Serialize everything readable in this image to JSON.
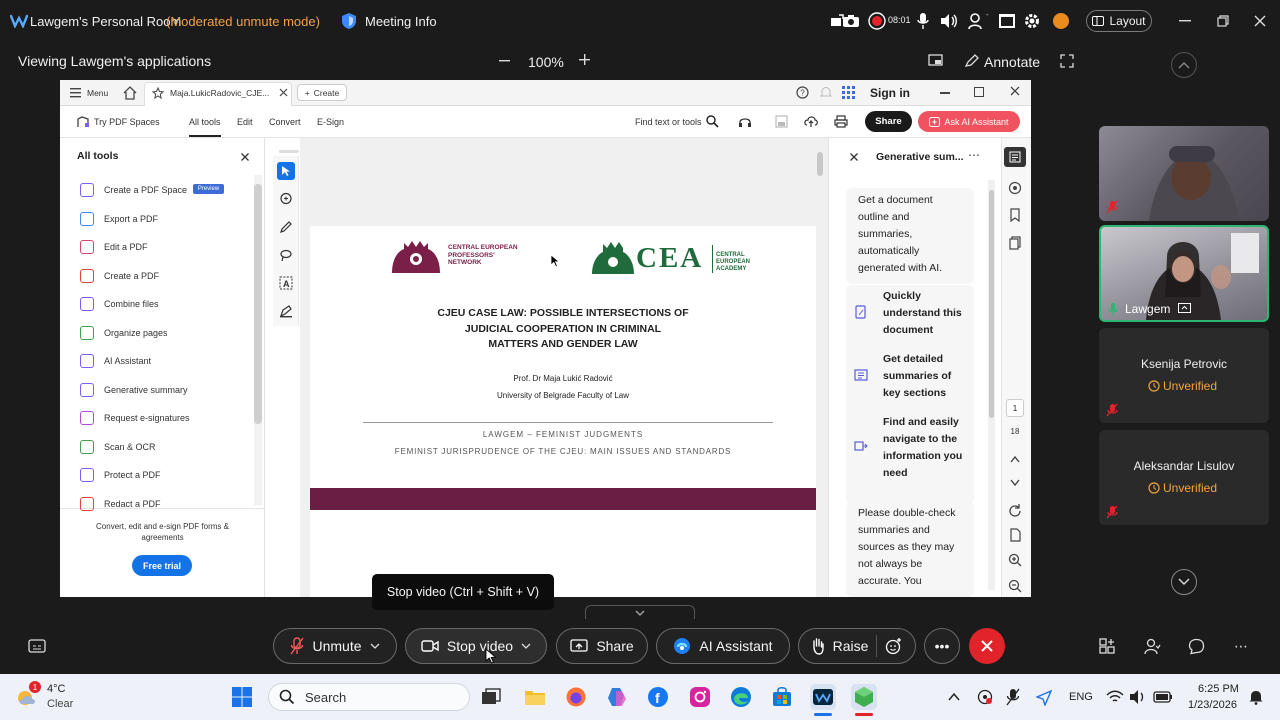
{
  "titlebar": {
    "room_name": "Lawgem's Personal Room",
    "mode": "(Moderated unmute mode)",
    "meeting_info": "Meeting Info",
    "clock_badge": "08:01",
    "layout": "Layout"
  },
  "sharebar": {
    "viewing": "Viewing Lawgem's applications",
    "zoom": "100%",
    "annotate": "Annotate"
  },
  "pdf": {
    "menu": "Menu",
    "tab_title": "Maja.LukicRadovic_CJE...",
    "create": "Create",
    "sign_in": "Sign in",
    "try_spaces": "Try PDF Spaces",
    "tabs": [
      "All tools",
      "Edit",
      "Convert",
      "E-Sign"
    ],
    "find_text": "Find text or tools",
    "share": "Share",
    "ask_ai": "Ask AI Assistant",
    "all_tools_title": "All tools",
    "tools": [
      {
        "label": "Create a PDF Space",
        "color": "#7a5cff"
      },
      {
        "label": "Export a PDF",
        "color": "#3d8af7"
      },
      {
        "label": "Edit a PDF",
        "color": "#d9466a"
      },
      {
        "label": "Create a PDF",
        "color": "#e0453a"
      },
      {
        "label": "Combine files",
        "color": "#7a5cff"
      },
      {
        "label": "Organize pages",
        "color": "#3fa34d"
      },
      {
        "label": "AI Assistant",
        "color": "#7a5cff"
      },
      {
        "label": "Generative summary",
        "color": "#7a5cff"
      },
      {
        "label": "Request e-signatures",
        "color": "#b04bd9"
      },
      {
        "label": "Scan & OCR",
        "color": "#3fa34d"
      },
      {
        "label": "Protect a PDF",
        "color": "#7a5cff"
      },
      {
        "label": "Redact a PDF",
        "color": "#e0453a"
      }
    ],
    "preview_badge": "Preview",
    "promo_text": "Convert, edit and e-sign PDF forms & agreements",
    "free_trial": "Free trial",
    "doc": {
      "logo_left": "CENTRAL EUROPEAN PROFESSORS' NETWORK",
      "logo_right_big": "CEA",
      "logo_right_small": "CENTRAL EUROPEAN ACADEMY",
      "title_1": "CJEU CASE LAW: POSSIBLE INTERSECTIONS OF",
      "title_2": "JUDICIAL COOPERATION IN CRIMINAL",
      "title_3": "MATTERS AND GENDER LAW",
      "author": "Prof. Dr Maja Lukić Radović",
      "affiliation": "University of Belgrade Faculty of Law",
      "series_1": "LAWGEM – FEMINIST JUDGMENTS",
      "series_2": "FEMINIST JURISPRUDENCE OF THE CJEU: MAIN ISSUES AND STANDARDS",
      "band_color": "#6b1e44"
    },
    "gen": {
      "title": "Generative sum...",
      "intro": "Get a document outline and summaries, automatically generated with AI.",
      "item_1": "Quickly understand this document",
      "item_2": "Get detailed summaries of key sections",
      "item_3": "Find and easily navigate to the information you need",
      "disclaimer": "Please double-check summaries and sources as they may not always be accurate. You"
    },
    "page_current": "1",
    "page_total": "18"
  },
  "participants": [
    {
      "name": "Lawgem"
    },
    {
      "name": "Ksenija Petrovic",
      "status": "Unverified"
    },
    {
      "name": "Aleksandar Lisulov",
      "status": "Unverified"
    }
  ],
  "controls": {
    "unmute": "Unmute",
    "stop_video": "Stop video",
    "share": "Share",
    "ai_assistant": "AI Assistant",
    "raise": "Raise",
    "tooltip": "Stop video (Ctrl + Shift + V)"
  },
  "taskbar": {
    "weather_temp": "4°C",
    "weather_desc": "Clear",
    "weather_badge": "1",
    "search": "Search",
    "lang": "ENG",
    "time": "6:25 PM",
    "date": "1/23/2026"
  },
  "colors": {
    "accent_red": "#e0242a",
    "webex_blue": "#1e7ff0",
    "unverified": "#f2a43a",
    "active_tile": "#2bb673"
  }
}
